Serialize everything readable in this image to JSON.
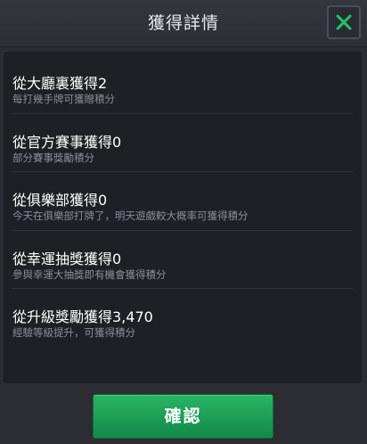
{
  "dialog": {
    "title": "獲得詳情",
    "close_icon": "close-icon",
    "accent_color": "#22a85a"
  },
  "items": [
    {
      "title": "從大廳裏獲得2",
      "description": "每打幾手牌可獲贈積分"
    },
    {
      "title": "從官方賽事獲得0",
      "description": "部分賽事獎勵積分"
    },
    {
      "title": "從俱樂部獲得0",
      "description": "今天在俱樂部打牌了，明天遊戲較大概率可獲得積分"
    },
    {
      "title": "從幸運抽獎獲得0",
      "description": "參與幸運大抽獎即有機會獲得積分"
    },
    {
      "title": "從升級獎勵獲得3,470",
      "description": "經驗等級提升，可獲得積分"
    }
  ],
  "footer": {
    "confirm_label": "確認"
  }
}
